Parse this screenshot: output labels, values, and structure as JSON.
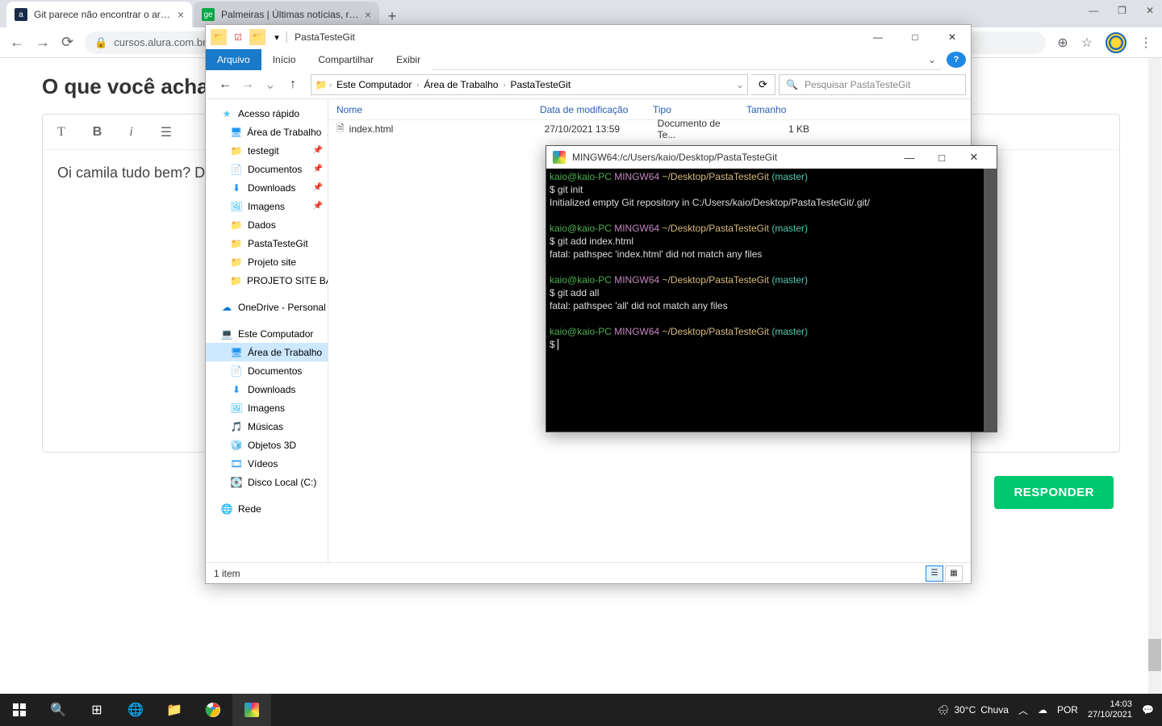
{
  "chrome": {
    "tabs": [
      {
        "title": "Git parece não encontrar o arqui",
        "favicon": "a"
      },
      {
        "title": "Palmeiras | Últimas notícias, resu",
        "favicon": "ge"
      }
    ],
    "url": "cursos.alura.com.br/",
    "window_controls": {
      "min": "—",
      "max": "❐",
      "close": "✕"
    }
  },
  "page": {
    "heading": "O que você acha diss",
    "editor_text": "Oi camila tudo bem? D",
    "responder": "RESPONDER"
  },
  "explorer": {
    "title": "PastaTesteGit",
    "menu": {
      "arquivo": "Arquivo",
      "inicio": "Início",
      "compartilhar": "Compartilhar",
      "exibir": "Exibir"
    },
    "breadcrumb": [
      "Este Computador",
      "Área de Trabalho",
      "PastaTesteGit"
    ],
    "search_placeholder": "Pesquisar PastaTesteGit",
    "tree": {
      "acesso_rapido": "Acesso rápido",
      "area_trabalho": "Área de Trabalho",
      "testegit": "testegit",
      "documentos": "Documentos",
      "downloads": "Downloads",
      "imagens": "Imagens",
      "dados": "Dados",
      "pastatestegit": "PastaTesteGit",
      "projeto_site": "Projeto site",
      "projeto_site_barb": "PROJETO SITE BARB",
      "onedrive": "OneDrive - Personal",
      "este_computador": "Este Computador",
      "musicas": "Músicas",
      "objetos3d": "Objetos 3D",
      "videos": "Vídeos",
      "disco_local": "Disco Local (C:)",
      "rede": "Rede"
    },
    "columns": {
      "nome": "Nome",
      "data": "Data de modificação",
      "tipo": "Tipo",
      "tamanho": "Tamanho"
    },
    "files": [
      {
        "name": "index.html",
        "date": "27/10/2021 13:59",
        "type": "Documento de Te...",
        "size": "1 KB"
      }
    ],
    "status": "1 item"
  },
  "terminal": {
    "title": "MINGW64:/c/Users/kaio/Desktop/PastaTesteGit",
    "prompt_user": "kaio@kaio-PC",
    "prompt_sys": "MINGW64",
    "prompt_path": "~/Desktop/PastaTesteGit",
    "prompt_branch": "(master)",
    "lines": {
      "cmd1": "$ git init",
      "out1": "Initialized empty Git repository in C:/Users/kaio/Desktop/PastaTesteGit/.git/",
      "cmd2": "$ git add index.html",
      "out2": "fatal: pathspec 'index.html' did not match any files",
      "cmd3": "$ git add all",
      "out3": "fatal: pathspec 'all' did not match any files",
      "cmd4": "$ "
    }
  },
  "taskbar": {
    "weather_temp": "30°C",
    "weather_desc": "Chuva",
    "lang": "POR",
    "time": "14:03",
    "date": "27/10/2021"
  }
}
